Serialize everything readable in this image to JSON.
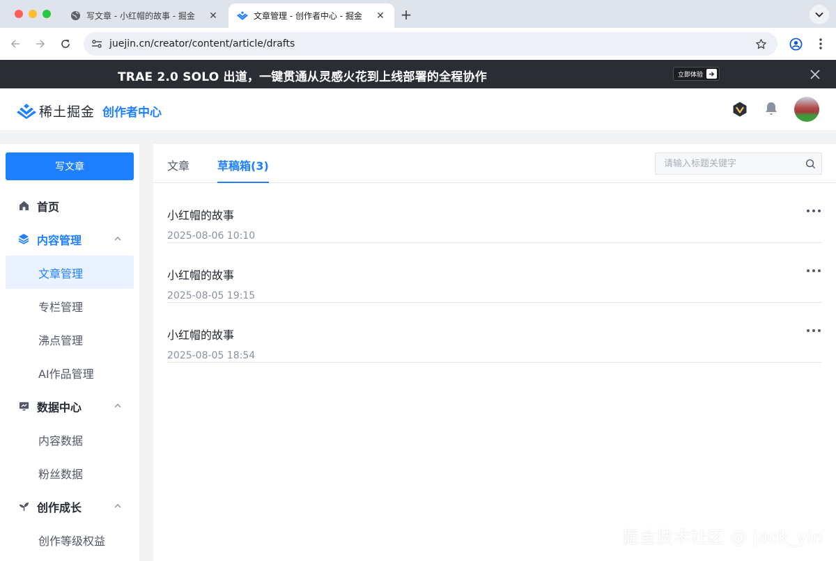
{
  "browser": {
    "tabs": [
      {
        "title": "写文章 - 小红帽的故事 - 掘金",
        "active": false
      },
      {
        "title": "文章管理 - 创作者中心 - 掘金",
        "active": true
      }
    ],
    "close_glyph": "✕",
    "new_tab_glyph": "+",
    "url": "juejin.cn/creator/content/article/drafts"
  },
  "banner": {
    "text": "TRAE 2.0  SOLO 出道，一键贯通从灵感火花到上线部署的全程协作",
    "cta_label": "立即体验"
  },
  "header": {
    "logo_text": "稀土掘金",
    "section_title": "创作者中心"
  },
  "sidebar": {
    "write_button": "写文章",
    "items": [
      {
        "label": "首页",
        "level": "top",
        "icon": "home-icon"
      },
      {
        "label": "内容管理",
        "level": "top",
        "icon": "layers-icon",
        "expanded": true,
        "active": true
      },
      {
        "label": "文章管理",
        "level": "sub",
        "selected": true
      },
      {
        "label": "专栏管理",
        "level": "sub"
      },
      {
        "label": "沸点管理",
        "level": "sub"
      },
      {
        "label": "AI作品管理",
        "level": "sub"
      },
      {
        "label": "数据中心",
        "level": "top",
        "icon": "monitor-chart-icon",
        "expanded": true
      },
      {
        "label": "内容数据",
        "level": "sub"
      },
      {
        "label": "粉丝数据",
        "level": "sub"
      },
      {
        "label": "创作成长",
        "level": "top",
        "icon": "sprout-icon",
        "expanded": true
      },
      {
        "label": "创作等级权益",
        "level": "sub"
      }
    ]
  },
  "content": {
    "tabs": [
      {
        "label": "文章",
        "active": false
      },
      {
        "label": "草稿箱(3)",
        "active": true
      }
    ],
    "search_placeholder": "请输入标题关键字",
    "drafts": [
      {
        "title": "小红帽的故事",
        "date": "2025-08-06 10:10"
      },
      {
        "title": "小红帽的故事",
        "date": "2025-08-05 19:15"
      },
      {
        "title": "小红帽的故事",
        "date": "2025-08-05 18:54"
      }
    ]
  },
  "watermark": "掘金技术社区 @ jack_yin",
  "colors": {
    "accent": "#1e80ff",
    "banner_bg": "#2a2d33",
    "selected_bg": "#eaf2ff"
  }
}
